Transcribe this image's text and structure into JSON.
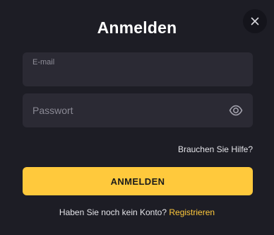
{
  "modal": {
    "title": "Anmelden"
  },
  "email_field": {
    "label": "E-mail",
    "value": ""
  },
  "password_field": {
    "placeholder": "Passwort",
    "value": ""
  },
  "help_link": "Brauchen Sie Hilfe?",
  "login_button": "ANMELDEN",
  "signup": {
    "prompt": "Haben Sie noch kein Konto?",
    "link": "Registrieren"
  },
  "icons": {
    "close": "close-icon",
    "toggle_password": "eye-icon"
  },
  "colors": {
    "background": "#1d1d25",
    "field_background": "#2b2a34",
    "accent": "#ffc93c",
    "text": "#ffffff",
    "muted": "#8a8994"
  }
}
